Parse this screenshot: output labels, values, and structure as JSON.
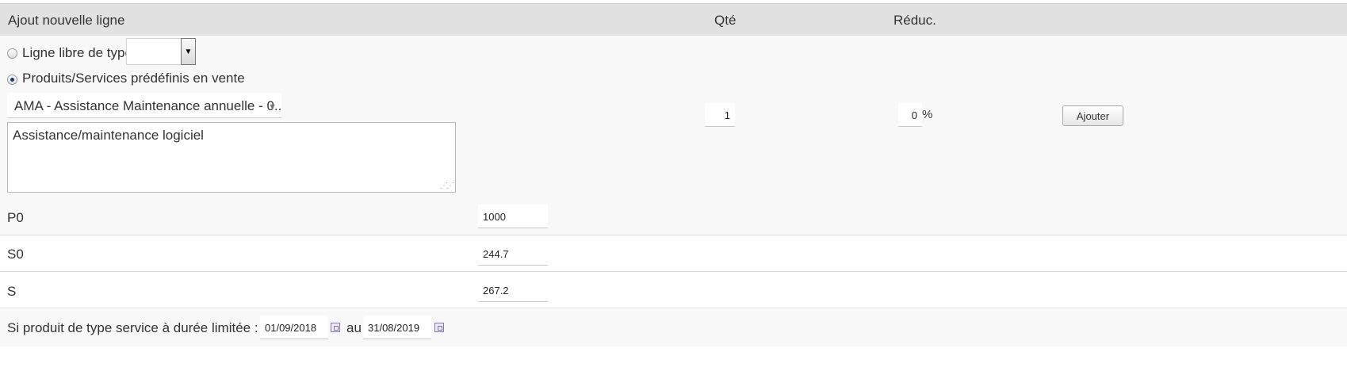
{
  "header": {
    "title": "Ajout nouvelle ligne",
    "qty_label": "Qté",
    "discount_label": "Réduc."
  },
  "line_type": {
    "free_line_label": "Ligne libre de type",
    "free_line_selected": false,
    "free_line_type_value": "",
    "predefined_label": "Produits/Services prédéfinis en vente",
    "predefined_selected": true
  },
  "product": {
    "selected": "AMA - Assistance Maintenance annuelle - 0...",
    "description": "Assistance/maintenance logiciel"
  },
  "qty": {
    "value": "1"
  },
  "discount": {
    "value": "0",
    "unit": "%"
  },
  "add_button": {
    "label": "Ajouter"
  },
  "fields": [
    {
      "label": "P0",
      "value": "1000"
    },
    {
      "label": "S0",
      "value": "244.7"
    },
    {
      "label": "S",
      "value": "267.2"
    }
  ],
  "service_period": {
    "label": "Si produit de type service à durée limitée : Du",
    "start_date": "01/09/2018",
    "between_label": "au",
    "end_date": "31/08/2019"
  },
  "icons": {
    "calendar": "calendar-icon",
    "dropdown": "chevron-down-icon",
    "resize": "resize-grip-icon"
  }
}
